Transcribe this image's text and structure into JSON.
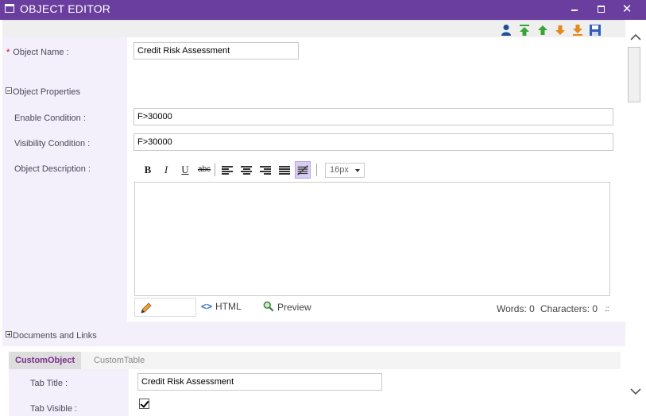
{
  "window": {
    "title": "OBJECT EDITOR",
    "buttons": [
      "minimize",
      "maximize",
      "close"
    ],
    "close_glyph": "✕"
  },
  "toolbar": {
    "icons": [
      "user-icon",
      "move-top-icon",
      "move-up-icon",
      "move-down-icon",
      "move-bottom-icon",
      "save-icon"
    ],
    "colors": {
      "user": "#1f4e9b",
      "green": "#3aa335",
      "orange": "#e58a1a",
      "save": "#2e5cb8"
    }
  },
  "form": {
    "object_name_label": "Object Name :",
    "object_name_value": "Credit Risk Assessment",
    "required_marker": "*",
    "object_properties_label": "Object Properties",
    "enable_condition_label": "Enable Condition :",
    "enable_condition_value": "F>30000",
    "visibility_condition_label": "Visibility Condition :",
    "visibility_condition_value": "F>30000",
    "object_description_label": "Object Description :"
  },
  "editor": {
    "bold": "B",
    "italic": "I",
    "underline": "U",
    "strikethrough": "abc",
    "font_size": "16px",
    "html_label": "HTML",
    "preview_label": "Preview",
    "words_label": "Words: 0",
    "characters_label": "Characters: 0",
    "grip": ".::",
    "html_glyph": "<>"
  },
  "documents_links_label": "Documents and Links",
  "tabs": [
    {
      "label": "CustomObject",
      "active": true
    },
    {
      "label": "CustomTable",
      "active": false
    }
  ],
  "tab_form": {
    "tab_title_label": "Tab Title :",
    "tab_title_value": "Credit Risk Assessment",
    "tab_visible_label": "Tab Visible :",
    "tab_visible_checked": true
  },
  "colors": {
    "titlebar": "#6a3e9e",
    "label_column": "#f3effb",
    "active_tab_text": "#7a2f8e"
  }
}
